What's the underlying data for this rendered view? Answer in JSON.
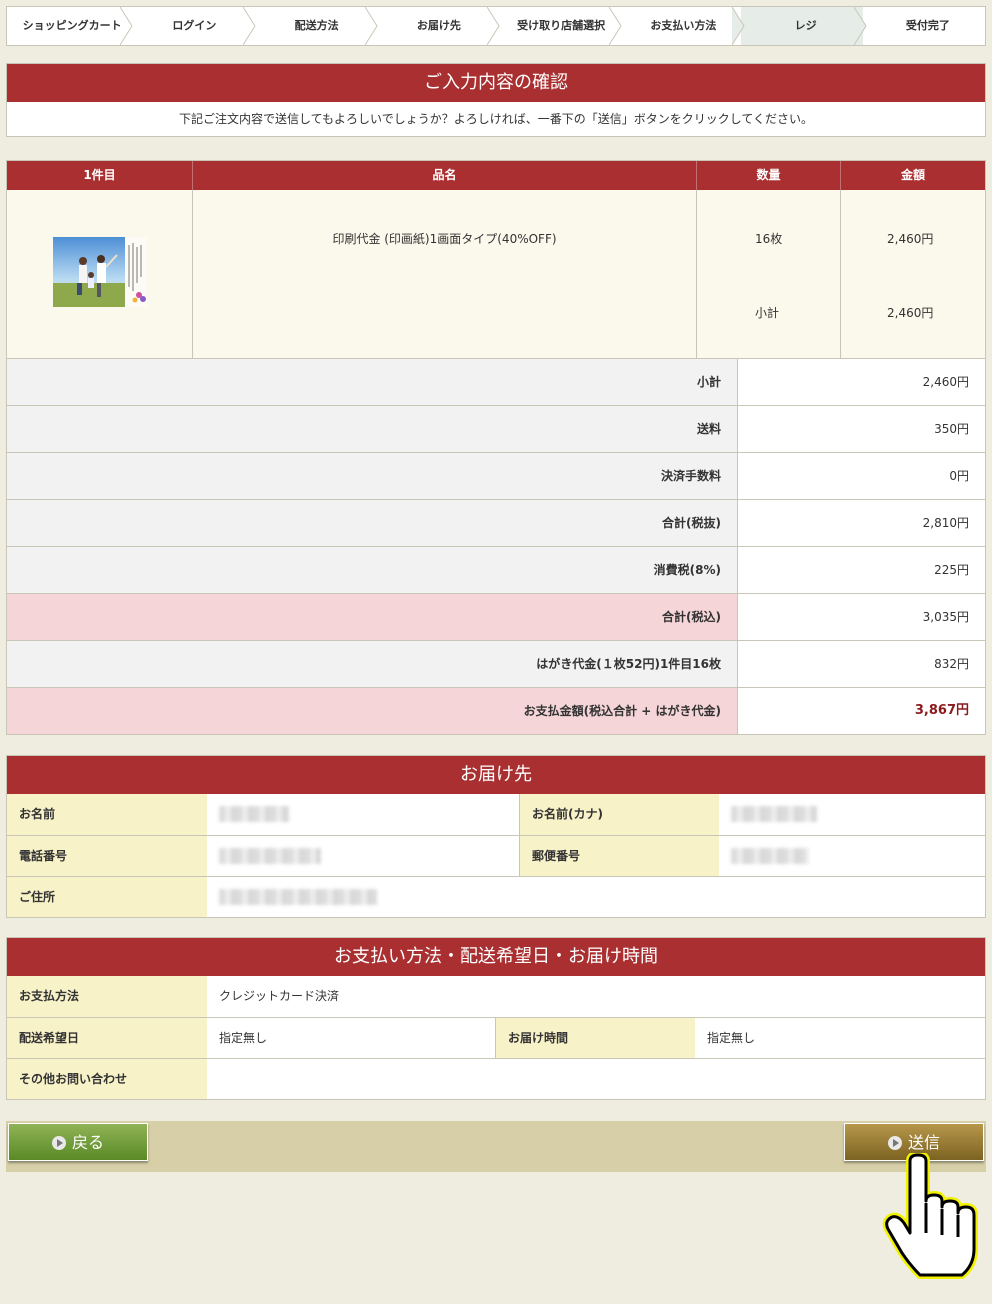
{
  "steps": [
    "ショッピングカート",
    "ログイン",
    "配送方法",
    "お届け先",
    "受け取り店舗選択",
    "お支払い方法",
    "レジ",
    "受付完了"
  ],
  "active_step_index": 6,
  "confirm": {
    "title": "ご入力内容の確認",
    "message": "下記ご注文内容で送信してもよろしいでしょうか？よろしければ、一番下の「送信」ボタンをクリックしてください。"
  },
  "order": {
    "headers": {
      "item": "1件目",
      "name": "品名",
      "qty": "数量",
      "amount": "金額"
    },
    "product_name": "印刷代金 (印画紙)1画面タイプ(40%OFF)",
    "qty": "16枚",
    "qty_amount": "2,460円",
    "subtotal_label": "小計",
    "subtotal_amount": "2,460円"
  },
  "summary": [
    {
      "label": "小計",
      "value": "2,460円"
    },
    {
      "label": "送料",
      "value": "350円"
    },
    {
      "label": "決済手数料",
      "value": "0円"
    },
    {
      "label": "合計(税抜)",
      "value": "2,810円"
    },
    {
      "label": "消費税(8%)",
      "value": "225円"
    },
    {
      "label": "合計(税込)",
      "value": "3,035円"
    },
    {
      "label": "はがき代金(１枚52円)1件目16枚",
      "value": "832円"
    },
    {
      "label": "お支払金額(税込合計 + はがき代金)",
      "value": "3,867円"
    }
  ],
  "delivery": {
    "title": "お届け先",
    "name_label": "お名前",
    "kana_label": "お名前(カナ)",
    "phone_label": "電話番号",
    "zip_label": "郵便番号",
    "address_label": "ご住所"
  },
  "payment": {
    "title": "お支払い方法・配送希望日・お届け時間",
    "method_label": "お支払方法",
    "method_value": "クレジットカード決済",
    "date_label": "配送希望日",
    "date_value": "指定無し",
    "time_label": "お届け時間",
    "time_value": "指定無し",
    "other_label": "その他お問い合わせ",
    "other_value": ""
  },
  "buttons": {
    "back": "戻る",
    "send": "送信"
  },
  "colors": {
    "header_red": "#a92f31",
    "label_yellow": "#f8f2c9",
    "pink": "#f5d5d7",
    "back_green": "#6f9a36",
    "send_gold": "#9a7c34"
  }
}
